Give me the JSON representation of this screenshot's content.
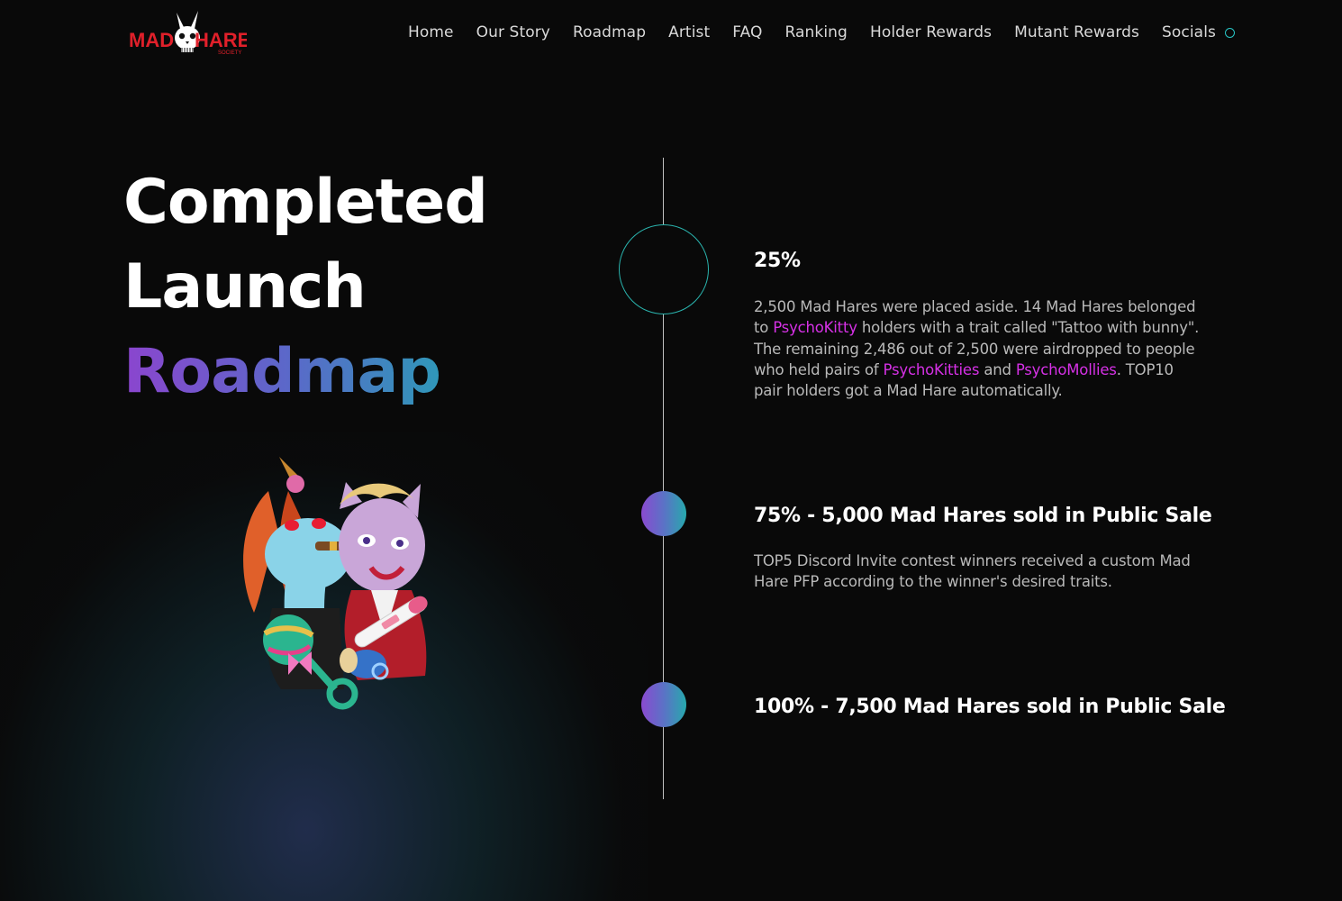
{
  "brand": {
    "logo_alt": "Mad Hare Society",
    "logo_word_left": "MAD",
    "logo_word_right": "HARE",
    "logo_sub": "SOCIETY"
  },
  "nav": {
    "items": [
      "Home",
      "Our Story",
      "Roadmap",
      "Artist",
      "FAQ",
      "Ranking",
      "Holder Rewards",
      "Mutant Rewards",
      "Socials"
    ],
    "socials_icon": "circle-icon"
  },
  "hero": {
    "line1": "Completed",
    "line2": "Launch",
    "line3": "Roadmap"
  },
  "timeline": [
    {
      "title": "25%",
      "desc_parts": {
        "p1": "2,500 Mad Hares were placed aside. 14 Mad Hares belonged to ",
        "link1": "PsychoKitty",
        "p2": " holders with a trait called \"Tattoo with bunny\". The remaining 2,486 out of 2,500 were airdropped to people who held pairs of ",
        "link2": "PsychoKitties",
        "p3": " and ",
        "link3": "PsychoMollies",
        "p4": ". TOP10 pair holders got a Mad Hare automatically."
      }
    },
    {
      "title": "75% - 5,000 Mad Hares sold in Public Sale",
      "desc": "TOP5 Discord Invite contest winners received a custom Mad Hare PFP according to the winner's desired traits."
    },
    {
      "title": "100% - 7,500 Mad Hares sold in Public Sale",
      "desc": ""
    }
  ],
  "colors": {
    "background": "#090909",
    "accent_teal": "#2ab3ad",
    "accent_purple": "#8b45ce",
    "link_magenta": "#d631e6",
    "logo_red": "#e0202a"
  }
}
